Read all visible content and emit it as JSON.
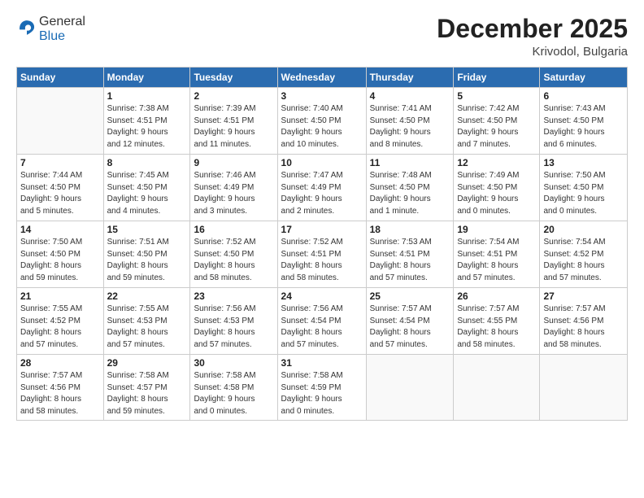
{
  "header": {
    "logo_general": "General",
    "logo_blue": "Blue",
    "month_year": "December 2025",
    "location": "Krivodol, Bulgaria"
  },
  "weekdays": [
    "Sunday",
    "Monday",
    "Tuesday",
    "Wednesday",
    "Thursday",
    "Friday",
    "Saturday"
  ],
  "weeks": [
    [
      {
        "day": "",
        "info": ""
      },
      {
        "day": "1",
        "info": "Sunrise: 7:38 AM\nSunset: 4:51 PM\nDaylight: 9 hours\nand 12 minutes."
      },
      {
        "day": "2",
        "info": "Sunrise: 7:39 AM\nSunset: 4:51 PM\nDaylight: 9 hours\nand 11 minutes."
      },
      {
        "day": "3",
        "info": "Sunrise: 7:40 AM\nSunset: 4:50 PM\nDaylight: 9 hours\nand 10 minutes."
      },
      {
        "day": "4",
        "info": "Sunrise: 7:41 AM\nSunset: 4:50 PM\nDaylight: 9 hours\nand 8 minutes."
      },
      {
        "day": "5",
        "info": "Sunrise: 7:42 AM\nSunset: 4:50 PM\nDaylight: 9 hours\nand 7 minutes."
      },
      {
        "day": "6",
        "info": "Sunrise: 7:43 AM\nSunset: 4:50 PM\nDaylight: 9 hours\nand 6 minutes."
      }
    ],
    [
      {
        "day": "7",
        "info": "Sunrise: 7:44 AM\nSunset: 4:50 PM\nDaylight: 9 hours\nand 5 minutes."
      },
      {
        "day": "8",
        "info": "Sunrise: 7:45 AM\nSunset: 4:50 PM\nDaylight: 9 hours\nand 4 minutes."
      },
      {
        "day": "9",
        "info": "Sunrise: 7:46 AM\nSunset: 4:49 PM\nDaylight: 9 hours\nand 3 minutes."
      },
      {
        "day": "10",
        "info": "Sunrise: 7:47 AM\nSunset: 4:49 PM\nDaylight: 9 hours\nand 2 minutes."
      },
      {
        "day": "11",
        "info": "Sunrise: 7:48 AM\nSunset: 4:50 PM\nDaylight: 9 hours\nand 1 minute."
      },
      {
        "day": "12",
        "info": "Sunrise: 7:49 AM\nSunset: 4:50 PM\nDaylight: 9 hours\nand 0 minutes."
      },
      {
        "day": "13",
        "info": "Sunrise: 7:50 AM\nSunset: 4:50 PM\nDaylight: 9 hours\nand 0 minutes."
      }
    ],
    [
      {
        "day": "14",
        "info": "Sunrise: 7:50 AM\nSunset: 4:50 PM\nDaylight: 8 hours\nand 59 minutes."
      },
      {
        "day": "15",
        "info": "Sunrise: 7:51 AM\nSunset: 4:50 PM\nDaylight: 8 hours\nand 59 minutes."
      },
      {
        "day": "16",
        "info": "Sunrise: 7:52 AM\nSunset: 4:50 PM\nDaylight: 8 hours\nand 58 minutes."
      },
      {
        "day": "17",
        "info": "Sunrise: 7:52 AM\nSunset: 4:51 PM\nDaylight: 8 hours\nand 58 minutes."
      },
      {
        "day": "18",
        "info": "Sunrise: 7:53 AM\nSunset: 4:51 PM\nDaylight: 8 hours\nand 57 minutes."
      },
      {
        "day": "19",
        "info": "Sunrise: 7:54 AM\nSunset: 4:51 PM\nDaylight: 8 hours\nand 57 minutes."
      },
      {
        "day": "20",
        "info": "Sunrise: 7:54 AM\nSunset: 4:52 PM\nDaylight: 8 hours\nand 57 minutes."
      }
    ],
    [
      {
        "day": "21",
        "info": "Sunrise: 7:55 AM\nSunset: 4:52 PM\nDaylight: 8 hours\nand 57 minutes."
      },
      {
        "day": "22",
        "info": "Sunrise: 7:55 AM\nSunset: 4:53 PM\nDaylight: 8 hours\nand 57 minutes."
      },
      {
        "day": "23",
        "info": "Sunrise: 7:56 AM\nSunset: 4:53 PM\nDaylight: 8 hours\nand 57 minutes."
      },
      {
        "day": "24",
        "info": "Sunrise: 7:56 AM\nSunset: 4:54 PM\nDaylight: 8 hours\nand 57 minutes."
      },
      {
        "day": "25",
        "info": "Sunrise: 7:57 AM\nSunset: 4:54 PM\nDaylight: 8 hours\nand 57 minutes."
      },
      {
        "day": "26",
        "info": "Sunrise: 7:57 AM\nSunset: 4:55 PM\nDaylight: 8 hours\nand 58 minutes."
      },
      {
        "day": "27",
        "info": "Sunrise: 7:57 AM\nSunset: 4:56 PM\nDaylight: 8 hours\nand 58 minutes."
      }
    ],
    [
      {
        "day": "28",
        "info": "Sunrise: 7:57 AM\nSunset: 4:56 PM\nDaylight: 8 hours\nand 58 minutes."
      },
      {
        "day": "29",
        "info": "Sunrise: 7:58 AM\nSunset: 4:57 PM\nDaylight: 8 hours\nand 59 minutes."
      },
      {
        "day": "30",
        "info": "Sunrise: 7:58 AM\nSunset: 4:58 PM\nDaylight: 9 hours\nand 0 minutes."
      },
      {
        "day": "31",
        "info": "Sunrise: 7:58 AM\nSunset: 4:59 PM\nDaylight: 9 hours\nand 0 minutes."
      },
      {
        "day": "",
        "info": ""
      },
      {
        "day": "",
        "info": ""
      },
      {
        "day": "",
        "info": ""
      }
    ]
  ]
}
